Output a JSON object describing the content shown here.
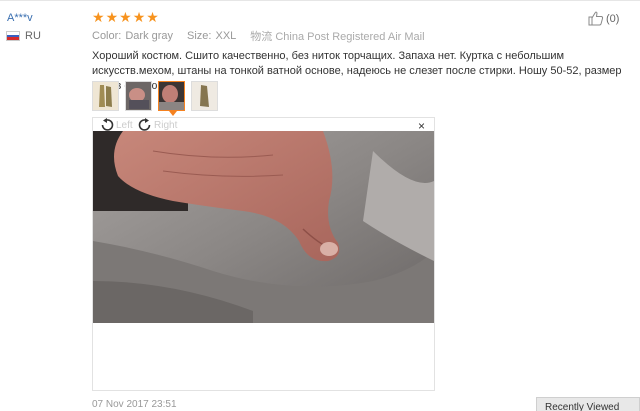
{
  "reviewer": {
    "name": "A***v",
    "country_code": "RU"
  },
  "rating": {
    "stars": 5,
    "max": 5
  },
  "meta": {
    "color_label": "Color:",
    "color_value": "Dark gray",
    "size_label": "Size:",
    "size_value": "XXL",
    "shipping_value": "物流 China Post Registered Air Mail"
  },
  "helpful": {
    "count": "(0)"
  },
  "review_text": "Хороший костюм. Сшито качественно, без ниток торчащих. Запаха нет. Куртка с небольшим искусств.мехом, штаны на тонкой ватной основе, надеюсь не слезет после стирки. Ношу 50-52, размер XXL в самую пору.",
  "thumbnails": [
    {
      "active": false
    },
    {
      "active": false
    },
    {
      "active": true
    },
    {
      "active": false
    }
  ],
  "viewer": {
    "rotate_left_label": "Left",
    "rotate_right_label": "Right",
    "close_symbol": "×"
  },
  "date": "07 Nov 2017 23:51",
  "recently_viewed": "Recently Viewed",
  "colors": {
    "star": "#f7931e",
    "link": "#3a6fb0",
    "active_thumb": "#f58220"
  }
}
